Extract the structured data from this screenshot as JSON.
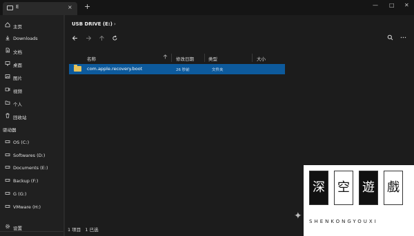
{
  "window": {
    "tab_label": "E",
    "tab_close": "×",
    "new_tab": "+",
    "minimize": "—",
    "maximize": "□",
    "close": "✕"
  },
  "sidebar": {
    "items": [
      {
        "label": "主页",
        "icon": "home-icon"
      },
      {
        "label": "Downloads",
        "icon": "download-icon"
      },
      {
        "label": "文档",
        "icon": "document-icon"
      },
      {
        "label": "桌面",
        "icon": "desktop-icon"
      },
      {
        "label": "图片",
        "icon": "image-icon"
      },
      {
        "label": "视频",
        "icon": "video-icon"
      },
      {
        "label": "个人",
        "icon": "person-icon"
      },
      {
        "label": "回收站",
        "icon": "trash-icon"
      }
    ],
    "section_label": "驱动器",
    "drives": [
      {
        "label": "OS (C:)"
      },
      {
        "label": "Softwares (D:)"
      },
      {
        "label": "Documents (E:)"
      },
      {
        "label": "Backup (F:)"
      },
      {
        "label": "G (G:)"
      },
      {
        "label": "VMware (H:)"
      }
    ],
    "settings_label": "设置"
  },
  "breadcrumb": {
    "location": "USB DRIVE (E:)",
    "chevron": "›"
  },
  "columns": {
    "name": "名称",
    "modified": "修改日期",
    "type": "类型",
    "size": "大小"
  },
  "rows": [
    {
      "name": "com.apple.recovery.boot",
      "modified": "26 秒前",
      "type": "文件夹",
      "selected": true
    }
  ],
  "status": {
    "count": "1 项目",
    "selected": "1 已选"
  },
  "watermark": {
    "chars": [
      "深",
      "空",
      "遊",
      "戲"
    ],
    "subtitle": "SHENKONGYOUXI"
  },
  "colors": {
    "selection": "#0d5a9c",
    "folder": "#e8c35a",
    "background": "#1c1c1c",
    "sidebar": "#202020"
  }
}
